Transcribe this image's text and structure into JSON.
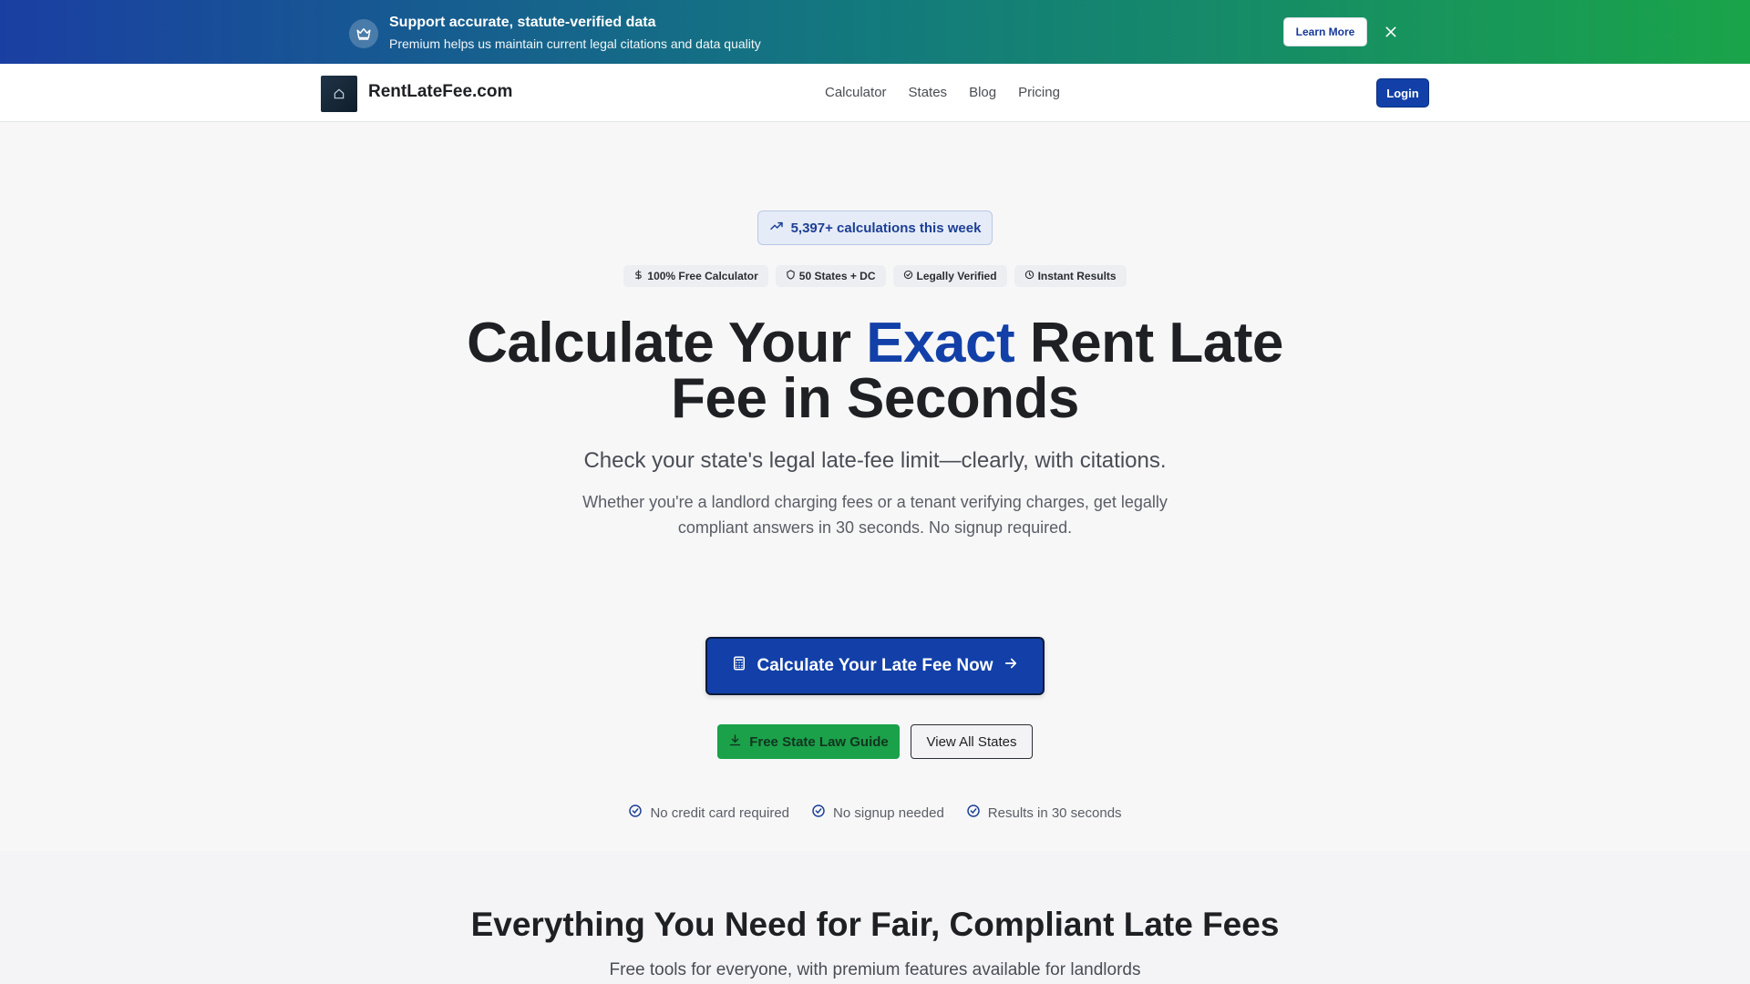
{
  "banner": {
    "title": "Support accurate, statute-verified data",
    "subtitle": "Premium helps us maintain current legal citations and data quality",
    "learn_more": "Learn More",
    "icon": "crown-icon",
    "close_icon": "close-icon"
  },
  "nav": {
    "brand": "RentLateFee.com",
    "links": [
      {
        "label": "Calculator"
      },
      {
        "label": "States"
      },
      {
        "label": "Blog"
      },
      {
        "label": "Pricing"
      }
    ],
    "login": "Login"
  },
  "hero": {
    "stat_pill": "5,397+ calculations this week",
    "badges": [
      {
        "icon": "dollar-icon",
        "label": "100% Free Calculator"
      },
      {
        "icon": "shield-icon",
        "label": "50 States + DC"
      },
      {
        "icon": "check-badge-icon",
        "label": "Legally Verified"
      },
      {
        "icon": "clock-icon",
        "label": "Instant Results"
      }
    ],
    "headline_part1": "Calculate Your ",
    "headline_accent": "Exact",
    "headline_part2": " Rent Late Fee in Seconds",
    "subhead": "Check your state's legal late-fee limit—clearly, with citations.",
    "description": "Whether you're a landlord charging fees or a tenant verifying charges, get legally compliant answers in 30 seconds. No signup required.",
    "cta_main": "Calculate Your Late Fee Now",
    "cta_guide": "Free State Law Guide",
    "cta_states": "View All States",
    "checks": [
      {
        "label": "No credit card required"
      },
      {
        "label": "No signup needed"
      },
      {
        "label": "Results in 30 seconds"
      }
    ]
  },
  "features": {
    "title": "Everything You Need for Fair, Compliant Late Fees",
    "subtitle": "Free tools for everyone, with premium features available for landlords"
  },
  "colors": {
    "accent": "#1240a8",
    "green": "#1ba14a"
  }
}
